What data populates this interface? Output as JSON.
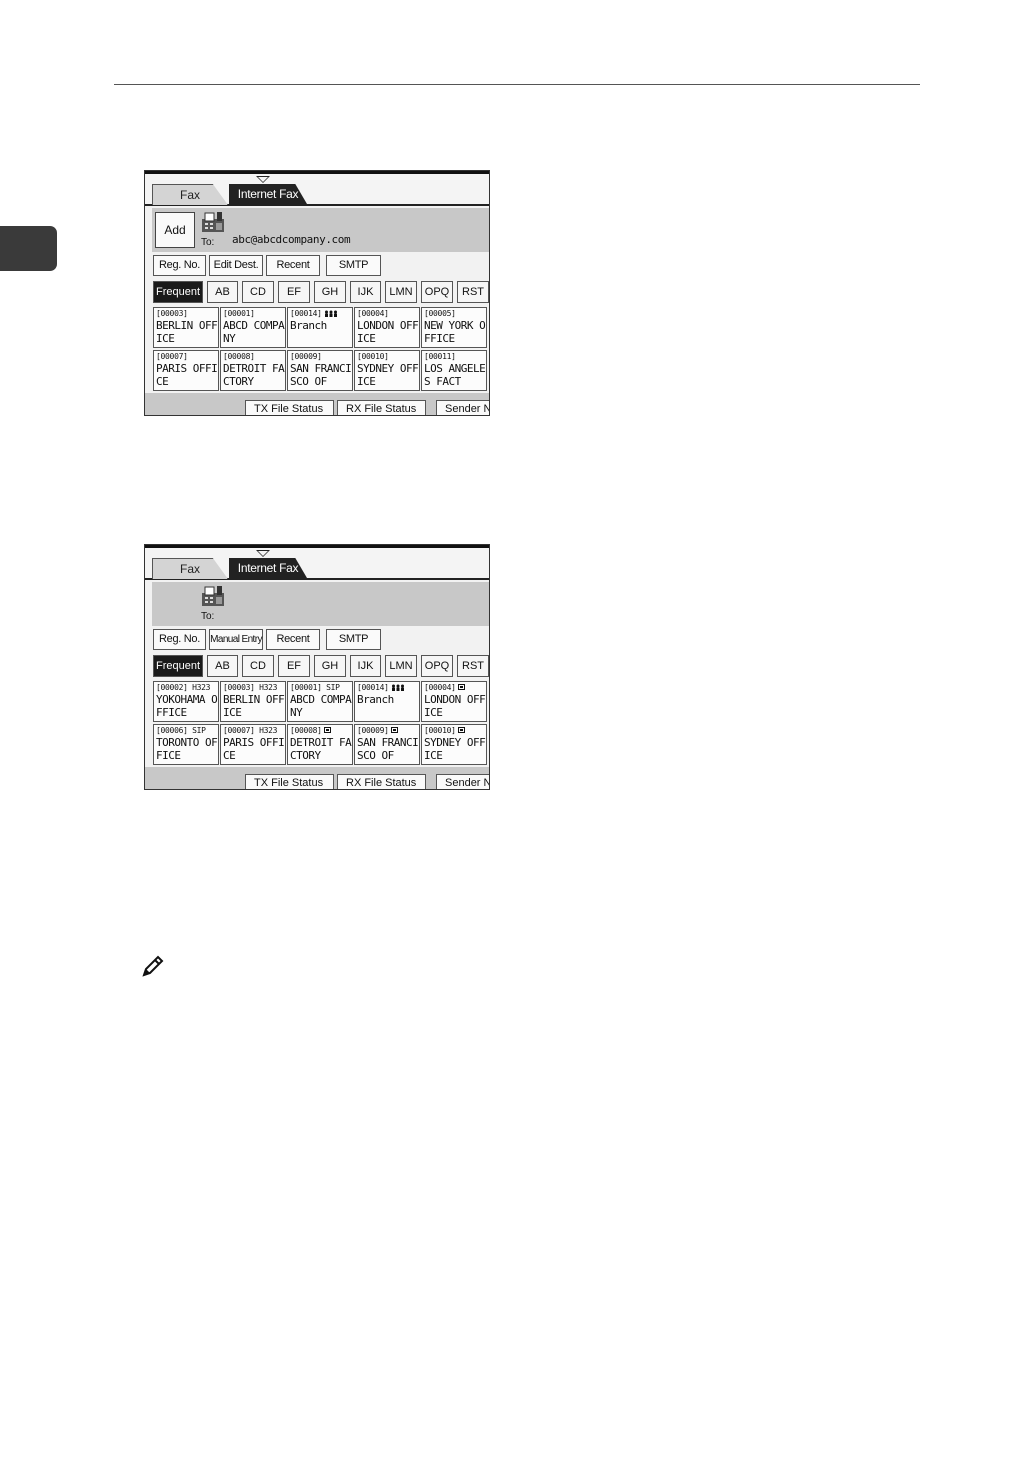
{
  "screen1": {
    "tabs": {
      "fax": "Fax",
      "internet_fax": "Internet Fax"
    },
    "add_label": "Add",
    "to_label": "To:",
    "destination": "abc@abcdcompany.com",
    "buttons": [
      "Reg. No.",
      "Edit Dest.",
      "Recent",
      "SMTP"
    ],
    "index_tabs": [
      "Frequent",
      "AB",
      "CD",
      "EF",
      "GH",
      "IJK",
      "LMN",
      "OPQ",
      "RST"
    ],
    "entries": [
      {
        "reg": "[00003]",
        "name": "BERLIN OFF\nICE"
      },
      {
        "reg": "[00001]",
        "name": "ABCD COMPA\nNY"
      },
      {
        "reg": "[00014]",
        "name": "Branch"
      },
      {
        "reg": "[00004]",
        "name": "LONDON OFF\nICE"
      },
      {
        "reg": "[00005]",
        "name": "NEW YORK O\nFFICE"
      },
      {
        "reg": "[00007]",
        "name": "PARIS OFFI\nCE"
      },
      {
        "reg": "[00008]",
        "name": "DETROIT FA\nCTORY"
      },
      {
        "reg": "[00009]",
        "name": "SAN FRANCI\nSCO OF"
      },
      {
        "reg": "[00010]",
        "name": "SYDNEY OFF\nICE"
      },
      {
        "reg": "[00011]",
        "name": "LOS ANGELE\nS FACT"
      }
    ],
    "bottom": [
      "TX File Status",
      "RX File Status",
      "Sender N"
    ]
  },
  "screen2": {
    "tabs": {
      "fax": "Fax",
      "internet_fax": "Internet Fax"
    },
    "to_label": "To:",
    "buttons": [
      "Reg. No.",
      "Manual Entry",
      "Recent",
      "SMTP"
    ],
    "index_tabs": [
      "Frequent",
      "AB",
      "CD",
      "EF",
      "GH",
      "IJK",
      "LMN",
      "OPQ",
      "RST"
    ],
    "entries": [
      {
        "reg": "[00002] H323",
        "name": "YOKOHAMA O\nFFICE"
      },
      {
        "reg": "[00003] H323",
        "name": "BERLIN OFF\nICE"
      },
      {
        "reg": "[00001] SIP",
        "name": "ABCD COMPA\nNY"
      },
      {
        "reg": "[00014]",
        "name": "Branch"
      },
      {
        "reg": "[00004]",
        "name": "LONDON OFF\nICE"
      },
      {
        "reg": "[00006] SIP",
        "name": "TORONTO OF\nFICE"
      },
      {
        "reg": "[00007] H323",
        "name": "PARIS OFFI\nCE"
      },
      {
        "reg": "[00008]",
        "name": "DETROIT FA\nCTORY"
      },
      {
        "reg": "[00009]",
        "name": "SAN FRANCI\nSCO OF"
      },
      {
        "reg": "[00010]",
        "name": "SYDNEY OFF\nICE"
      }
    ],
    "bottom": [
      "TX File Status",
      "RX File Status",
      "Sender N"
    ]
  }
}
